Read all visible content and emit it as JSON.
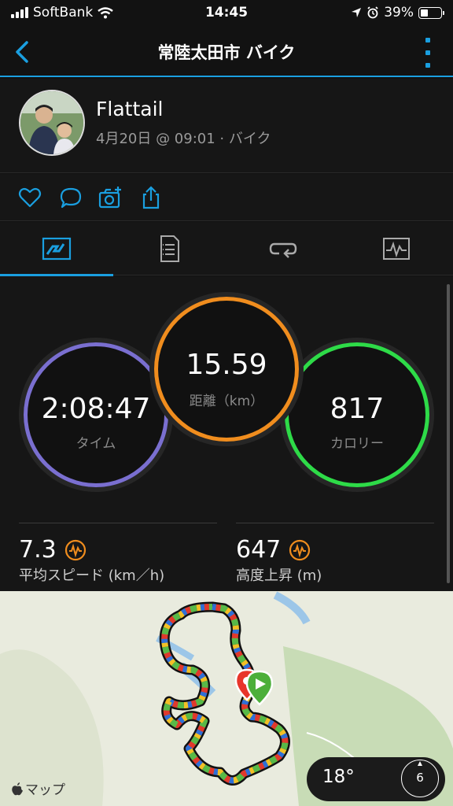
{
  "status_bar": {
    "carrier": "SoftBank",
    "time": "14:45",
    "battery": "39%",
    "battery_level": 0.39
  },
  "header": {
    "title": "常陸太田市 バイク"
  },
  "profile": {
    "name": "Flattail",
    "meta": "4月20日 @ 09:01 · バイク"
  },
  "actions": [
    "heart-icon",
    "comment-icon",
    "add-photo-icon",
    "share-icon"
  ],
  "tabs": [
    "overview-tab",
    "details-tab",
    "laps-tab",
    "charts-tab"
  ],
  "stats": {
    "time": {
      "value": "2:08:47",
      "label": "タイム"
    },
    "distance": {
      "value": "15.59",
      "label": "距離（km）"
    },
    "calories": {
      "value": "817",
      "label": "カロリー"
    },
    "avg_speed": {
      "value": "7.3",
      "label": "平均スピード (km／h)"
    },
    "elevation": {
      "value": "647",
      "label": "高度上昇 (m)"
    }
  },
  "map": {
    "credit": "マップ",
    "temperature": "18°",
    "wind": "6"
  },
  "colors": {
    "accent": "#1a9fe0",
    "time_ring": "#7a6fd0",
    "distance_ring": "#f08d1e",
    "calories_ring": "#2edb48"
  }
}
